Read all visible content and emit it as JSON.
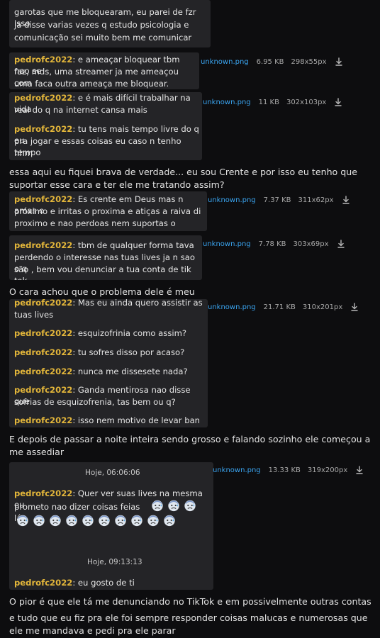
{
  "shot1": {
    "lines": [
      "garotas que me bloquearam, eu parei de fzr isso",
      "ja disse varias vezes q estudo psicologia e",
      "comunicação sei muito bem me comunicar"
    ]
  },
  "shot2": {
    "user": "pedrofc2022",
    "lines": [
      "e ameaçar bloquear tbm nao se",
      "faz, mds, uma streamer ja me ameaçou com",
      "uma faca outra ameaça me bloquear."
    ],
    "file": {
      "name": "unknown.png",
      "size": "6.95 KB",
      "dims": "298x55px"
    }
  },
  "shot3": {
    "user1": "pedrofc2022",
    "msg1_lines": [
      "e é mais difícil trabalhar na vida",
      "real do q na internet cansa mais"
    ],
    "user2": "pedrofc2022",
    "msg2_lines": [
      "tu tens mais tempo livre do q eu",
      "pra jogar e essas coisas eu caso n tenho tempo",
      "nhm"
    ],
    "file": {
      "name": "unknown.png",
      "size": "11 KB",
      "dims": "302x103px"
    }
  },
  "caption1": "essa aqui eu fiquei brava de verdade... eu sou Crente e por isso eu tenho que suportar esse cara e ter ele me tratando assim?",
  "shot4": {
    "user": "pedrofc2022",
    "lines": [
      "Es crente em Deus mas n amas o",
      "próximo e irritas o proxima e atiças a raiva di",
      "proximo e nao perdoas nem suportas o proximo"
    ],
    "file": {
      "name": "unknown.png",
      "size": "7.37 KB",
      "dims": "311x62px"
    }
  },
  "shot5": {
    "user": "pedrofc2022",
    "lines": [
      "tbm de qualquer forma tava",
      "perdendo o interesse nas tuas lives ja n sao o q",
      "são , bem vou denunciar a tua conta de tik tok"
    ],
    "file": {
      "name": "unknown.png",
      "size": "7.78 KB",
      "dims": "303x69px"
    }
  },
  "caption2": "O cara achou que o problema dele é meu",
  "shot6": {
    "first_user": "pedrofc2022",
    "first_lines": [
      "Mas eu ainda quero assistir as",
      "tuas lives"
    ],
    "messages": [
      {
        "user": "pedrofc2022",
        "text": "esquizofrinia como assim?"
      },
      {
        "user": "pedrofc2022",
        "text": "tu sofres disso por acaso?"
      },
      {
        "user": "pedrofc2022",
        "text": "nunca me dissesete nada?"
      },
      {
        "user": "pedrofc2022",
        "text": "Ganda mentirosa nao disse que",
        "text2": "sofrias de esquizofrenia, tas bem ou q?"
      },
      {
        "user": "pedrofc2022",
        "text": "isso nem motivo de levar ban"
      }
    ],
    "file": {
      "name": "unknown.png",
      "size": "21.71 KB",
      "dims": "310x201px"
    }
  },
  "caption3": "E depois de passar a noite inteira sendo grosso e falando sozinho ele começou a me assediar",
  "shot7": {
    "time1": "Hoje, 06:06:06",
    "user1": "pedrofc2022",
    "msg1_lines": [
      "Quer ver suas lives na mesma eu",
      "prometo nao dizer coisas feias lá"
    ],
    "emoji_icon": "cold-sweat-face-icon",
    "emoji_count": 13,
    "time2": "Hoje, 09:13:13",
    "user2": "pedrofc2022",
    "msg2": "eu gosto de ti",
    "file": {
      "name": "unknown.png",
      "size": "13.33 KB",
      "dims": "319x200px"
    }
  },
  "caption4": "O pior é que ele tá me denunciando no TikTok e em possivelmente outras contas",
  "caption5": "e tudo que eu fiz pra ele foi sempre responder coisas malucas e numerosas que ele me mandava e pedi pra ele parar",
  "colors": {
    "username": "#e3b63a",
    "filename": "#3aa4f0",
    "screenshot_bg": "#242427",
    "page_bg": "#0d0d0f"
  }
}
